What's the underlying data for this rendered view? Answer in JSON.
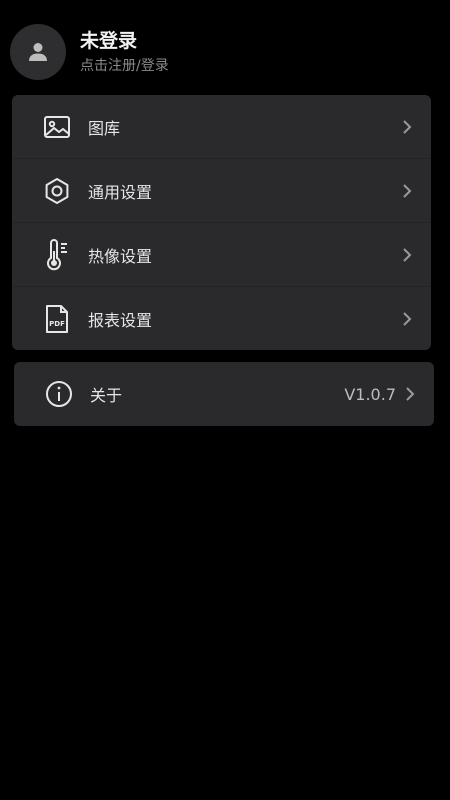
{
  "profile": {
    "name": "未登录",
    "hint": "点击注册/登录",
    "avatar_icon": "user-icon"
  },
  "menu": {
    "items": [
      {
        "label": "图库",
        "icon": "image-icon"
      },
      {
        "label": "通用设置",
        "icon": "gear-icon"
      },
      {
        "label": "热像设置",
        "icon": "thermometer-icon"
      },
      {
        "label": "报表设置",
        "icon": "pdf-icon"
      }
    ]
  },
  "about": {
    "label": "关于",
    "version": "V1.0.7",
    "icon": "info-icon"
  },
  "icons": {
    "pdf_text": "PDF"
  },
  "colors": {
    "background": "#000000",
    "card": "#2a2a2c",
    "text_primary": "#e6e6e6",
    "text_secondary": "#8a8a8a"
  }
}
